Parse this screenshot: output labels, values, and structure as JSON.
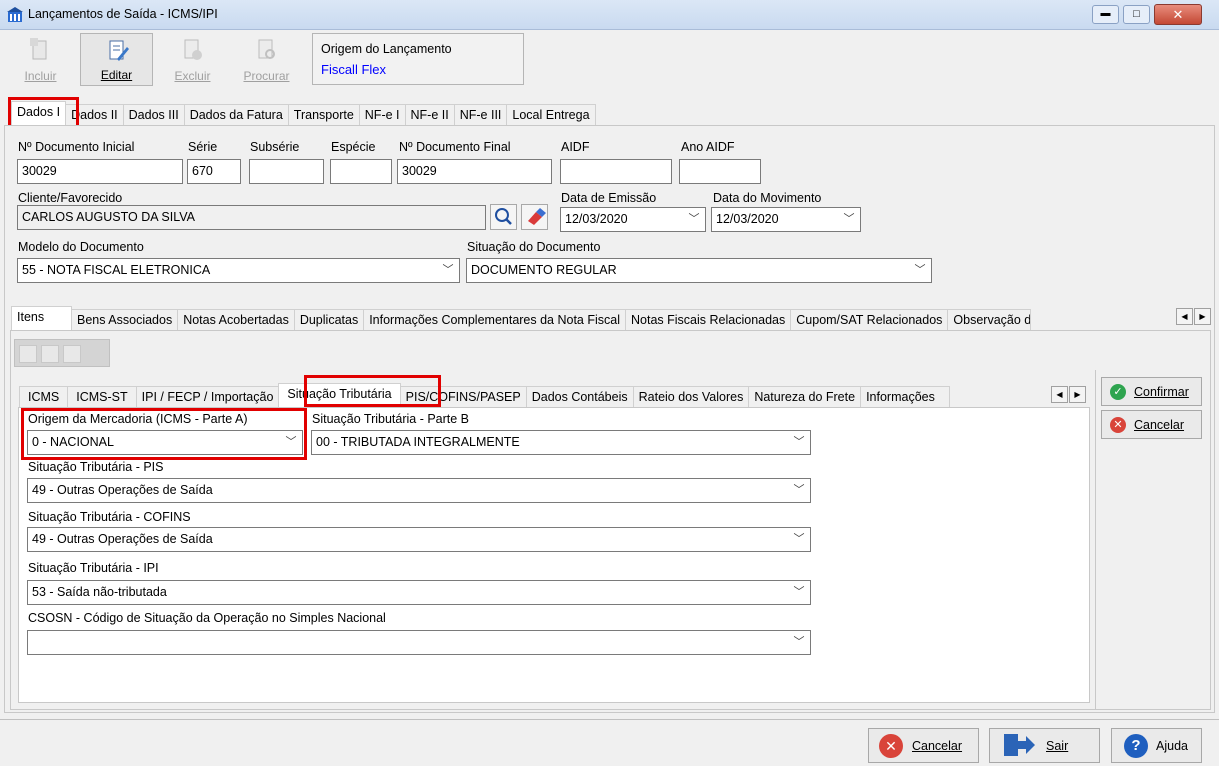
{
  "window": {
    "title": "Lançamentos de Saída - ICMS/IPI",
    "controls": {
      "minimize": "▭",
      "maximize": "□",
      "close": "✕"
    }
  },
  "toolbar": {
    "incluir": "Incluir",
    "editar": "Editar",
    "excluir": "Excluir",
    "procurar": "Procurar",
    "origem_label": "Origem do Lançamento",
    "origem_value": "Fiscall Flex"
  },
  "main_tabs": [
    "Dados I",
    "Dados II",
    "Dados III",
    "Dados da Fatura",
    "Transporte",
    "NF-e I",
    "NF-e II",
    "NF-e III",
    "Local Entrega"
  ],
  "dados1": {
    "doc_inicial_label": "Nº Documento Inicial",
    "doc_inicial": "30029",
    "serie_label": "Série",
    "serie": "670",
    "subserie_label": "Subsérie",
    "subserie": "",
    "especie_label": "Espécie",
    "especie": "",
    "doc_final_label": "Nº Documento Final",
    "doc_final": "30029",
    "aidf_label": "AIDF",
    "aidf": "",
    "ano_aidf_label": "Ano AIDF",
    "ano_aidf": "",
    "cliente_label": "Cliente/Favorecido",
    "cliente": "CARLOS AUGUSTO DA SILVA",
    "data_emissao_label": "Data de Emissão",
    "data_emissao": "12/03/2020",
    "data_movimento_label": "Data do Movimento",
    "data_movimento": "12/03/2020",
    "modelo_label": "Modelo do Documento",
    "modelo": "55 - NOTA FISCAL ELETRONICA",
    "situacao_doc_label": "Situação do Documento",
    "situacao_doc": "DOCUMENTO REGULAR"
  },
  "sub_tabs": [
    "Itens",
    "Bens Associados",
    "Notas Acobertadas",
    "Duplicatas",
    "Informações Complementares da Nota Fiscal",
    "Notas Fiscais Relacionadas",
    "Cupom/SAT Relacionados",
    "Observação d"
  ],
  "item_tabs": [
    "ICMS",
    "ICMS-ST",
    "IPI / FECP / Importação",
    "Situação Tributária",
    "PIS/COFINS/PASEP",
    "Dados Contábeis",
    "Rateio dos Valores",
    "Natureza do Frete",
    "Informações"
  ],
  "situacao": {
    "origem_label": "Origem da Mercadoria (ICMS - Parte A)",
    "origem": "0 - NACIONAL",
    "parte_b_label": "Situação Tributária - Parte B",
    "parte_b": "00 - TRIBUTADA INTEGRALMENTE",
    "pis_label": "Situação Tributária - PIS",
    "pis": "49 - Outras Operações de Saída",
    "cofins_label": "Situação Tributária - COFINS",
    "cofins": "49 - Outras Operações de Saída",
    "ipi_label": "Situação Tributária - IPI",
    "ipi": "53 - Saída não-tributada",
    "csosn_label": "CSOSN - Código de Situação da Operação no Simples Nacional",
    "csosn": ""
  },
  "side_buttons": {
    "confirmar": "Confirmar",
    "cancelar": "Cancelar"
  },
  "footer": {
    "cancelar": "Cancelar",
    "sair": "Sair",
    "ajuda": "Ajuda"
  },
  "colors": {
    "highlight": "#e10000",
    "link_blue": "#0000ff",
    "title_bar": "#d6e4f5"
  }
}
